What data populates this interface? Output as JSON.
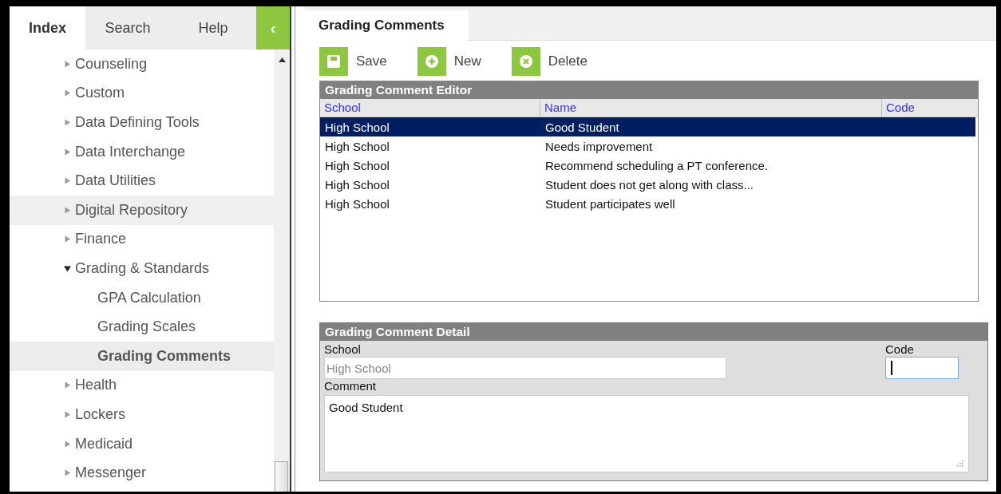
{
  "sidebar": {
    "tabs": [
      {
        "label": "Index",
        "selected": true
      },
      {
        "label": "Search",
        "selected": false
      },
      {
        "label": "Help",
        "selected": false
      }
    ],
    "collapse_button": "‹",
    "tree": [
      {
        "label": "Counseling",
        "expanded": false,
        "selected": false,
        "hovered": false
      },
      {
        "label": "Custom",
        "expanded": false,
        "selected": false,
        "hovered": false
      },
      {
        "label": "Data Defining Tools",
        "expanded": false,
        "selected": false,
        "hovered": false
      },
      {
        "label": "Data Interchange",
        "expanded": false,
        "selected": false,
        "hovered": false
      },
      {
        "label": "Data Utilities",
        "expanded": false,
        "selected": false,
        "hovered": false
      },
      {
        "label": "Digital Repository",
        "expanded": false,
        "selected": false,
        "hovered": true
      },
      {
        "label": "Finance",
        "expanded": false,
        "selected": false,
        "hovered": false
      },
      {
        "label": "Grading & Standards",
        "expanded": true,
        "selected": false,
        "hovered": false,
        "children": [
          {
            "label": "GPA Calculation",
            "selected": false,
            "hovered": false
          },
          {
            "label": "Grading Scales",
            "selected": false,
            "hovered": false
          },
          {
            "label": "Grading Comments",
            "selected": true,
            "hovered": false
          }
        ]
      },
      {
        "label": "Health",
        "expanded": false,
        "selected": false,
        "hovered": false
      },
      {
        "label": "Lockers",
        "expanded": false,
        "selected": false,
        "hovered": false
      },
      {
        "label": "Medicaid",
        "expanded": false,
        "selected": false,
        "hovered": false
      },
      {
        "label": "Messenger",
        "expanded": false,
        "selected": false,
        "hovered": false
      }
    ]
  },
  "main": {
    "tab": "Grading Comments",
    "toolbar": [
      {
        "kind": "save",
        "label": "Save"
      },
      {
        "kind": "new",
        "label": "New"
      },
      {
        "kind": "delete",
        "label": "Delete"
      }
    ],
    "editor": {
      "title": "Grading Comment Editor",
      "columns": [
        "School",
        "Name",
        "Code"
      ],
      "rows": [
        {
          "school": "High School",
          "name": "Good Student",
          "selected": true
        },
        {
          "school": "High School",
          "name": "Needs improvement",
          "selected": false
        },
        {
          "school": "High School",
          "name": "Recommend scheduling a PT conference.",
          "selected": false
        },
        {
          "school": "High School",
          "name": "Student does not get along with class...",
          "selected": false
        },
        {
          "school": "High School",
          "name": "Student participates well",
          "selected": false
        }
      ]
    },
    "detail": {
      "title": "Grading Comment Detail",
      "school": {
        "label": "School",
        "value": "High School",
        "disabled": true
      },
      "code": {
        "label": "Code",
        "focused": true
      },
      "comment": {
        "label": "Comment",
        "value": "Good Student"
      }
    }
  }
}
